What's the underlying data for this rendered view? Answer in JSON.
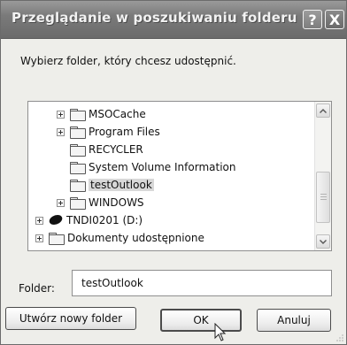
{
  "window": {
    "title": "Przeglądanie w poszukiwaniu folderu",
    "help_label": "?",
    "close_label": "X"
  },
  "instruction": "Wybierz folder, który chcesz udostępnić.",
  "tree": {
    "items": [
      {
        "label": "MSOCache",
        "icon": "folder-icon",
        "expandable": true
      },
      {
        "label": "Program Files",
        "icon": "folder-icon",
        "expandable": true
      },
      {
        "label": "RECYCLER",
        "icon": "folder-icon",
        "expandable": false
      },
      {
        "label": "System Volume Information",
        "icon": "folder-icon",
        "expandable": false
      },
      {
        "label": "testOutlook",
        "icon": "folder-icon",
        "expandable": false,
        "selected": true
      },
      {
        "label": "WINDOWS",
        "icon": "folder-icon",
        "expandable": true
      },
      {
        "label": "TNDI0201 (D:)",
        "icon": "drive-icon",
        "expandable": true
      },
      {
        "label": "Dokumenty udostępnione",
        "icon": "folder-icon",
        "expandable": true
      }
    ]
  },
  "folder_field": {
    "label": "Folder:",
    "value": "testOutlook"
  },
  "buttons": {
    "new_folder": "Utwórz nowy folder",
    "ok": "OK",
    "cancel": "Anuluj"
  }
}
